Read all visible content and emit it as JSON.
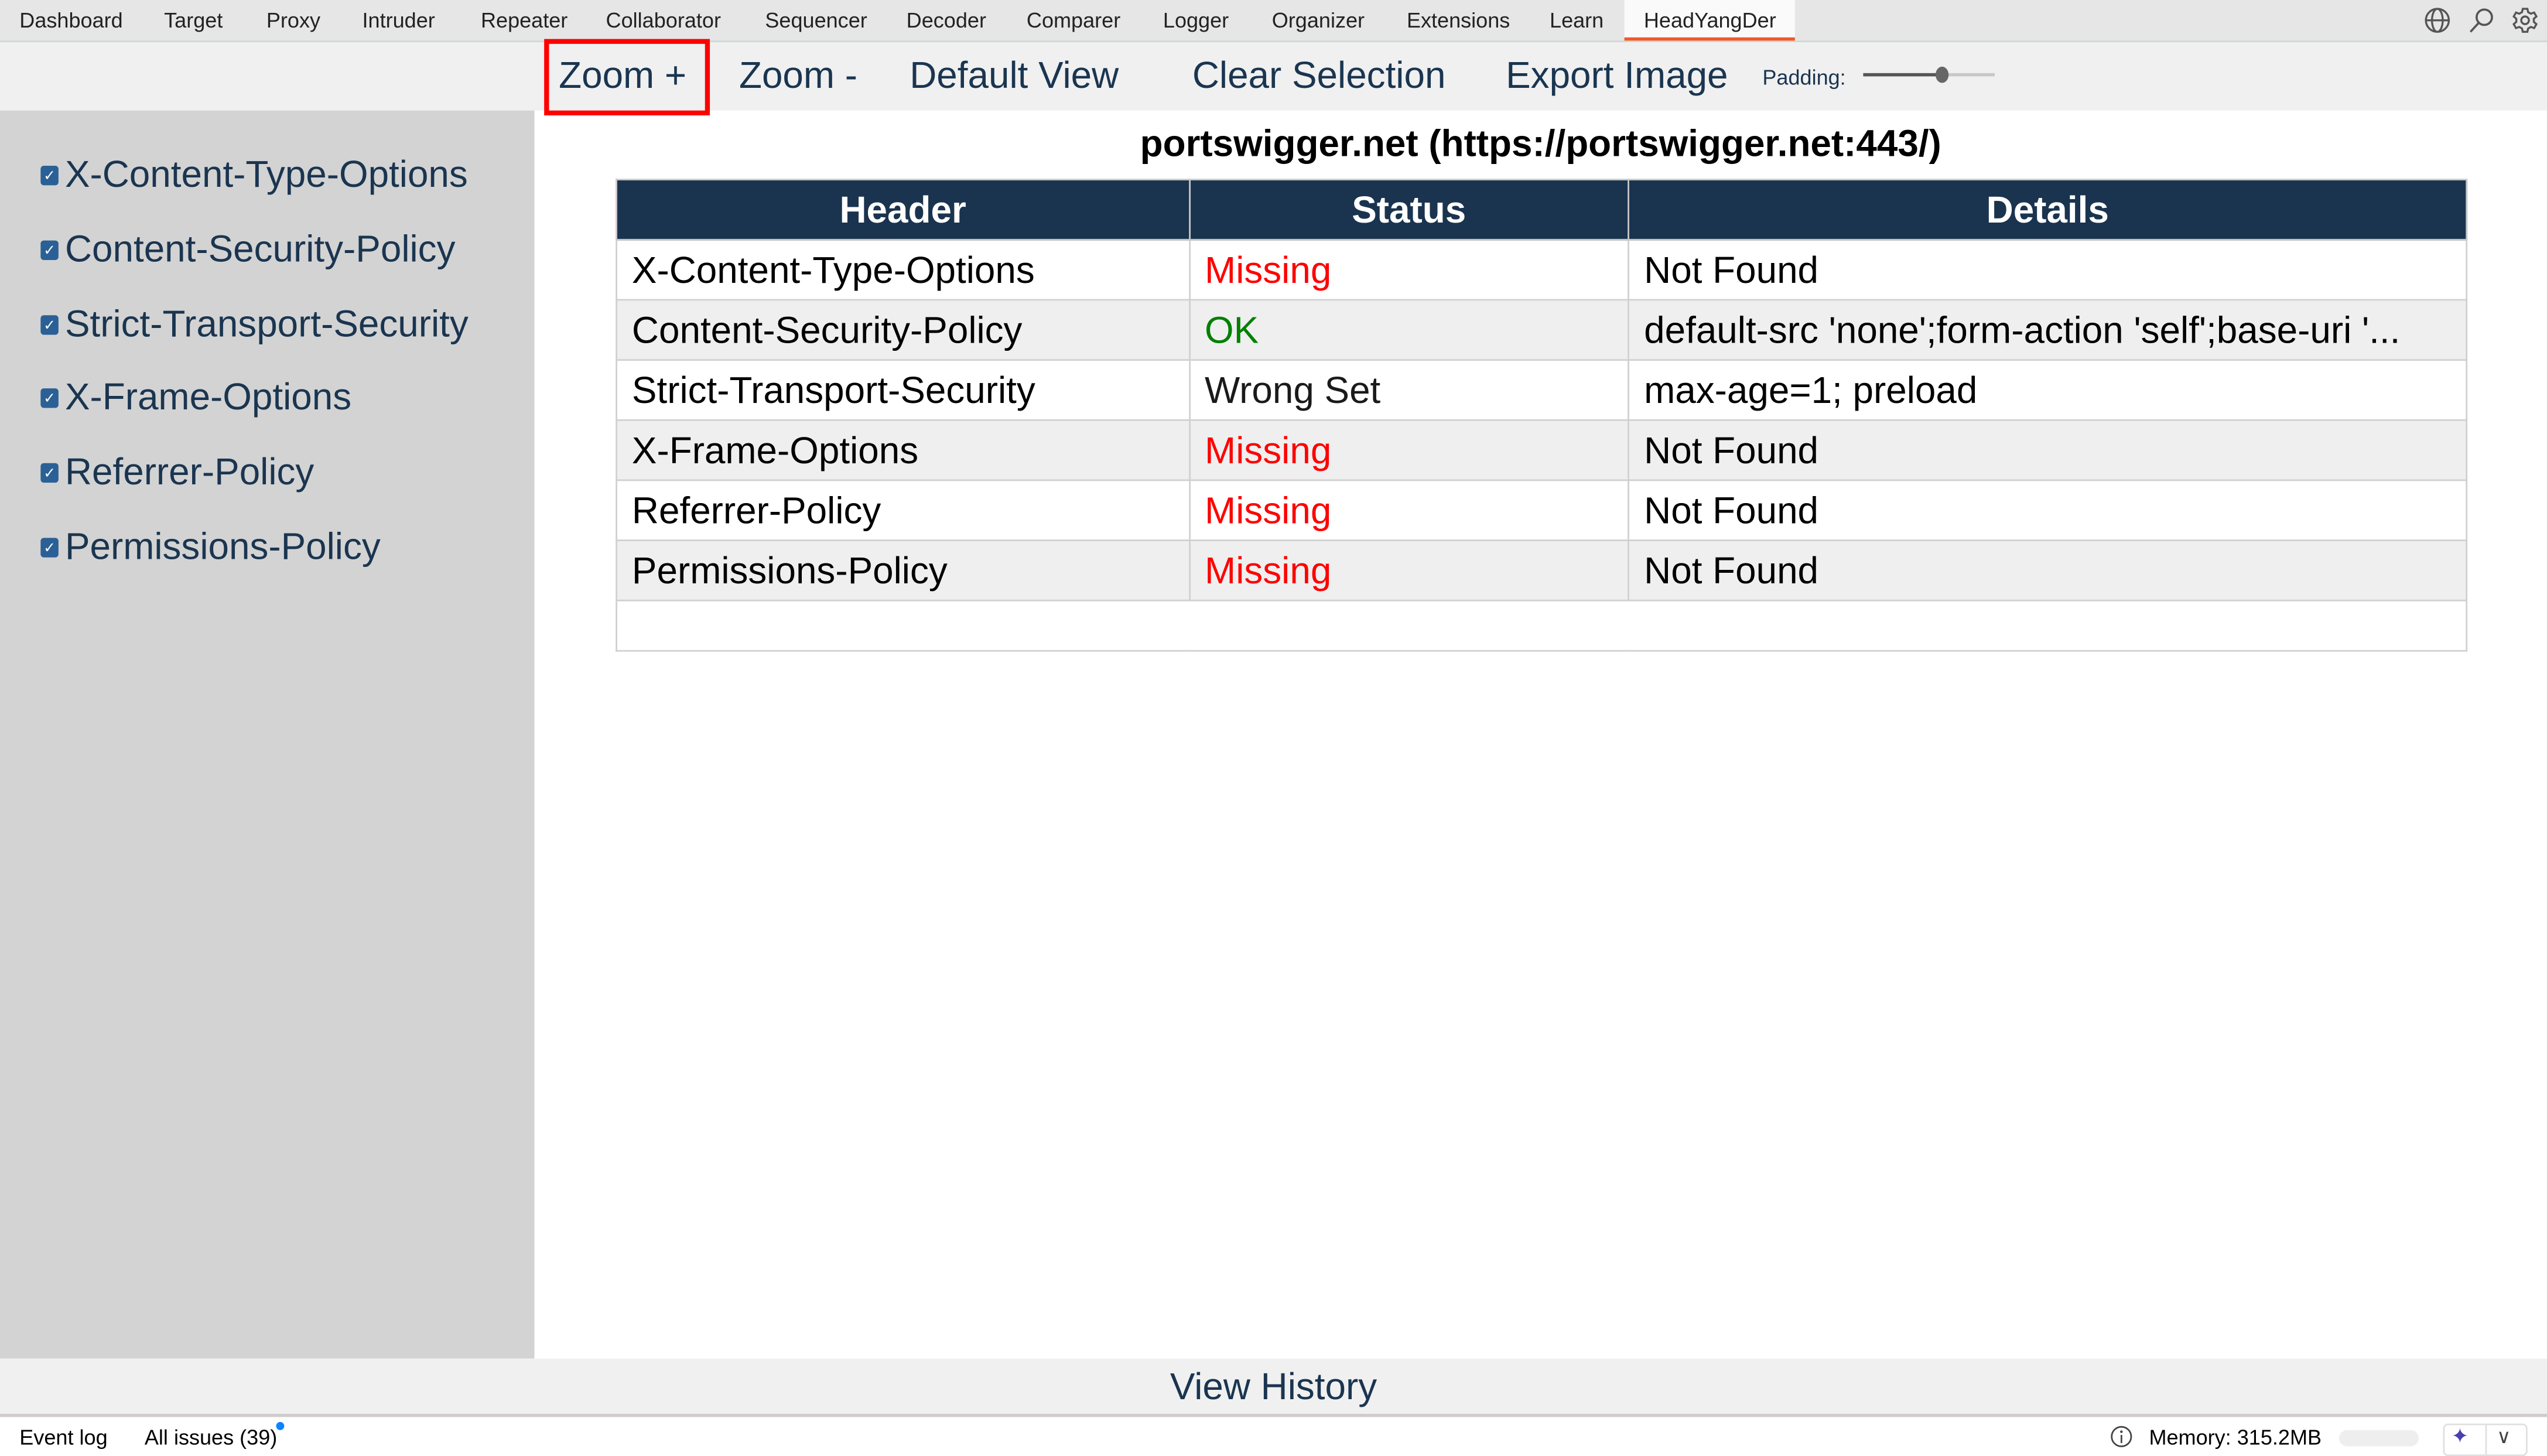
{
  "topnav": {
    "tabs": [
      "Dashboard",
      "Target",
      "Proxy",
      "Intruder",
      "Repeater",
      "Collaborator",
      "Sequencer",
      "Decoder",
      "Comparer",
      "Logger",
      "Organizer",
      "Extensions",
      "Learn",
      "HeadYangDer"
    ],
    "active": "HeadYangDer",
    "icons": [
      "globe-icon",
      "search-icon",
      "gear-icon"
    ]
  },
  "toolbar": {
    "zoom_in": "Zoom +",
    "zoom_out": "Zoom -",
    "default_view": "Default View",
    "clear_selection": "Clear Selection",
    "export_image": "Export Image",
    "padding_label": "Padding:",
    "padding_value": 0.6,
    "highlight_color": "#ff0000"
  },
  "sidebar": {
    "items": [
      {
        "label": "X-Content-Type-Options",
        "checked": true
      },
      {
        "label": "Content-Security-Policy",
        "checked": true
      },
      {
        "label": "Strict-Transport-Security",
        "checked": true
      },
      {
        "label": "X-Frame-Options",
        "checked": true
      },
      {
        "label": "Referrer-Policy",
        "checked": true
      },
      {
        "label": "Permissions-Policy",
        "checked": true
      }
    ]
  },
  "main": {
    "title": "portswigger.net (https://portswigger.net:443/)",
    "columns": [
      "Header",
      "Status",
      "Details"
    ],
    "rows": [
      {
        "header": "X-Content-Type-Options",
        "status": "Missing",
        "details": "Not Found"
      },
      {
        "header": "Content-Security-Policy",
        "status": "OK",
        "details": "default-src 'none';form-action 'self';base-uri '..."
      },
      {
        "header": "Strict-Transport-Security",
        "status": "Wrong Set",
        "details": "max-age=1; preload"
      },
      {
        "header": "X-Frame-Options",
        "status": "Missing",
        "details": "Not Found"
      },
      {
        "header": "Referrer-Policy",
        "status": "Missing",
        "details": "Not Found"
      },
      {
        "header": "Permissions-Policy",
        "status": "Missing",
        "details": "Not Found"
      }
    ],
    "status_colors": {
      "Missing": "#ff0000",
      "OK": "#008000",
      "Wrong Set": "#1a1a1a"
    },
    "header_bg": "#1a344f"
  },
  "footer": {
    "view_history": "View History"
  },
  "statusbar": {
    "event_log": "Event log",
    "all_issues": "All issues (39)",
    "memory": "Memory: 315.2MB"
  }
}
